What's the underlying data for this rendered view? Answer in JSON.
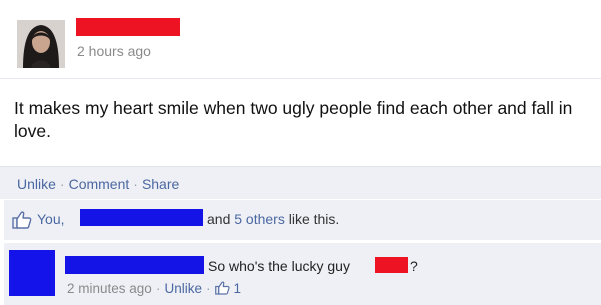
{
  "post": {
    "timestamp": "2 hours ago",
    "text": "It makes my heart smile when two ugly people find each other and fall in love.",
    "actions": {
      "unlike": "Unlike",
      "comment": "Comment",
      "share": "Share"
    }
  },
  "likes": {
    "you": "You,",
    "rest_prefix": "and ",
    "others": "5 others",
    "rest_suffix": " like this."
  },
  "comment": {
    "text": "So who's the lucky guy",
    "qmark": "?",
    "time": "2 minutes ago",
    "unlike": "Unlike",
    "like_count": "1"
  },
  "colors": {
    "redaction_red": "#ee1322",
    "redaction_blue": "#1414e6",
    "link_blue": "#4b67a1",
    "bar_bg": "#eef0f5"
  },
  "icons": {
    "like": "thumbs-up-icon",
    "avatar": "profile-photo"
  },
  "separator": "·"
}
